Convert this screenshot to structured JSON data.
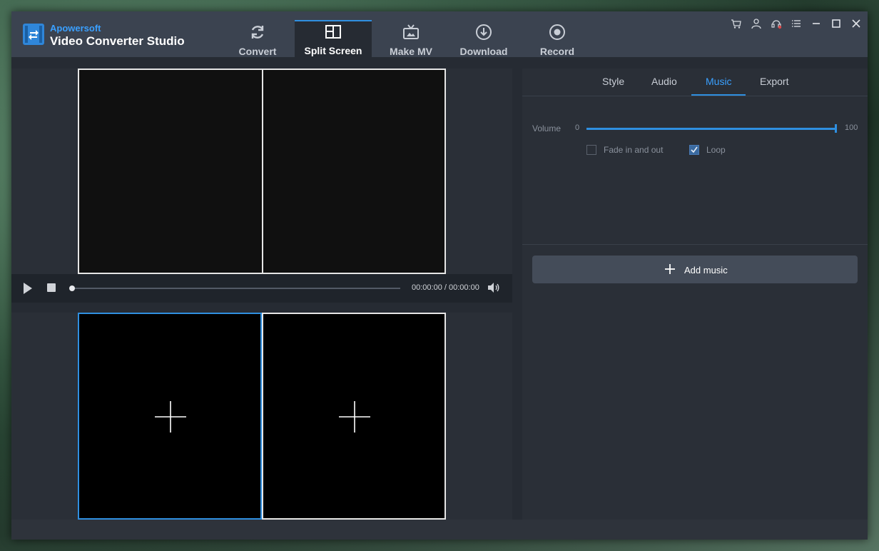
{
  "app": {
    "brand": "Apowersoft",
    "product": "Video Converter Studio"
  },
  "nav": {
    "items": [
      {
        "label": "Convert",
        "icon": "refresh-icon"
      },
      {
        "label": "Split Screen",
        "icon": "split-screen-icon"
      },
      {
        "label": "Make MV",
        "icon": "tv-icon"
      },
      {
        "label": "Download",
        "icon": "download-icon"
      },
      {
        "label": "Record",
        "icon": "record-icon"
      }
    ],
    "active": "Split Screen"
  },
  "titlebar_icons": [
    "cart-icon",
    "user-icon",
    "support-icon",
    "menu-icon",
    "minimize-icon",
    "maximize-icon",
    "close-icon"
  ],
  "player": {
    "timecode": "00:00:00 / 00:00:00",
    "progress": 0
  },
  "right_panel": {
    "tabs": [
      "Style",
      "Audio",
      "Music",
      "Export"
    ],
    "active_tab": "Music",
    "volume": {
      "label": "Volume",
      "min": "0",
      "max": "100",
      "value": 100
    },
    "fade": {
      "label": "Fade in and out",
      "checked": false
    },
    "loop": {
      "label": "Loop",
      "checked": true
    },
    "add_music_label": "Add music"
  },
  "colors": {
    "accent": "#2f8fe0",
    "brand": "#3aa0ff",
    "titlebar": "#3b4350",
    "panel": "#2a2f37"
  }
}
